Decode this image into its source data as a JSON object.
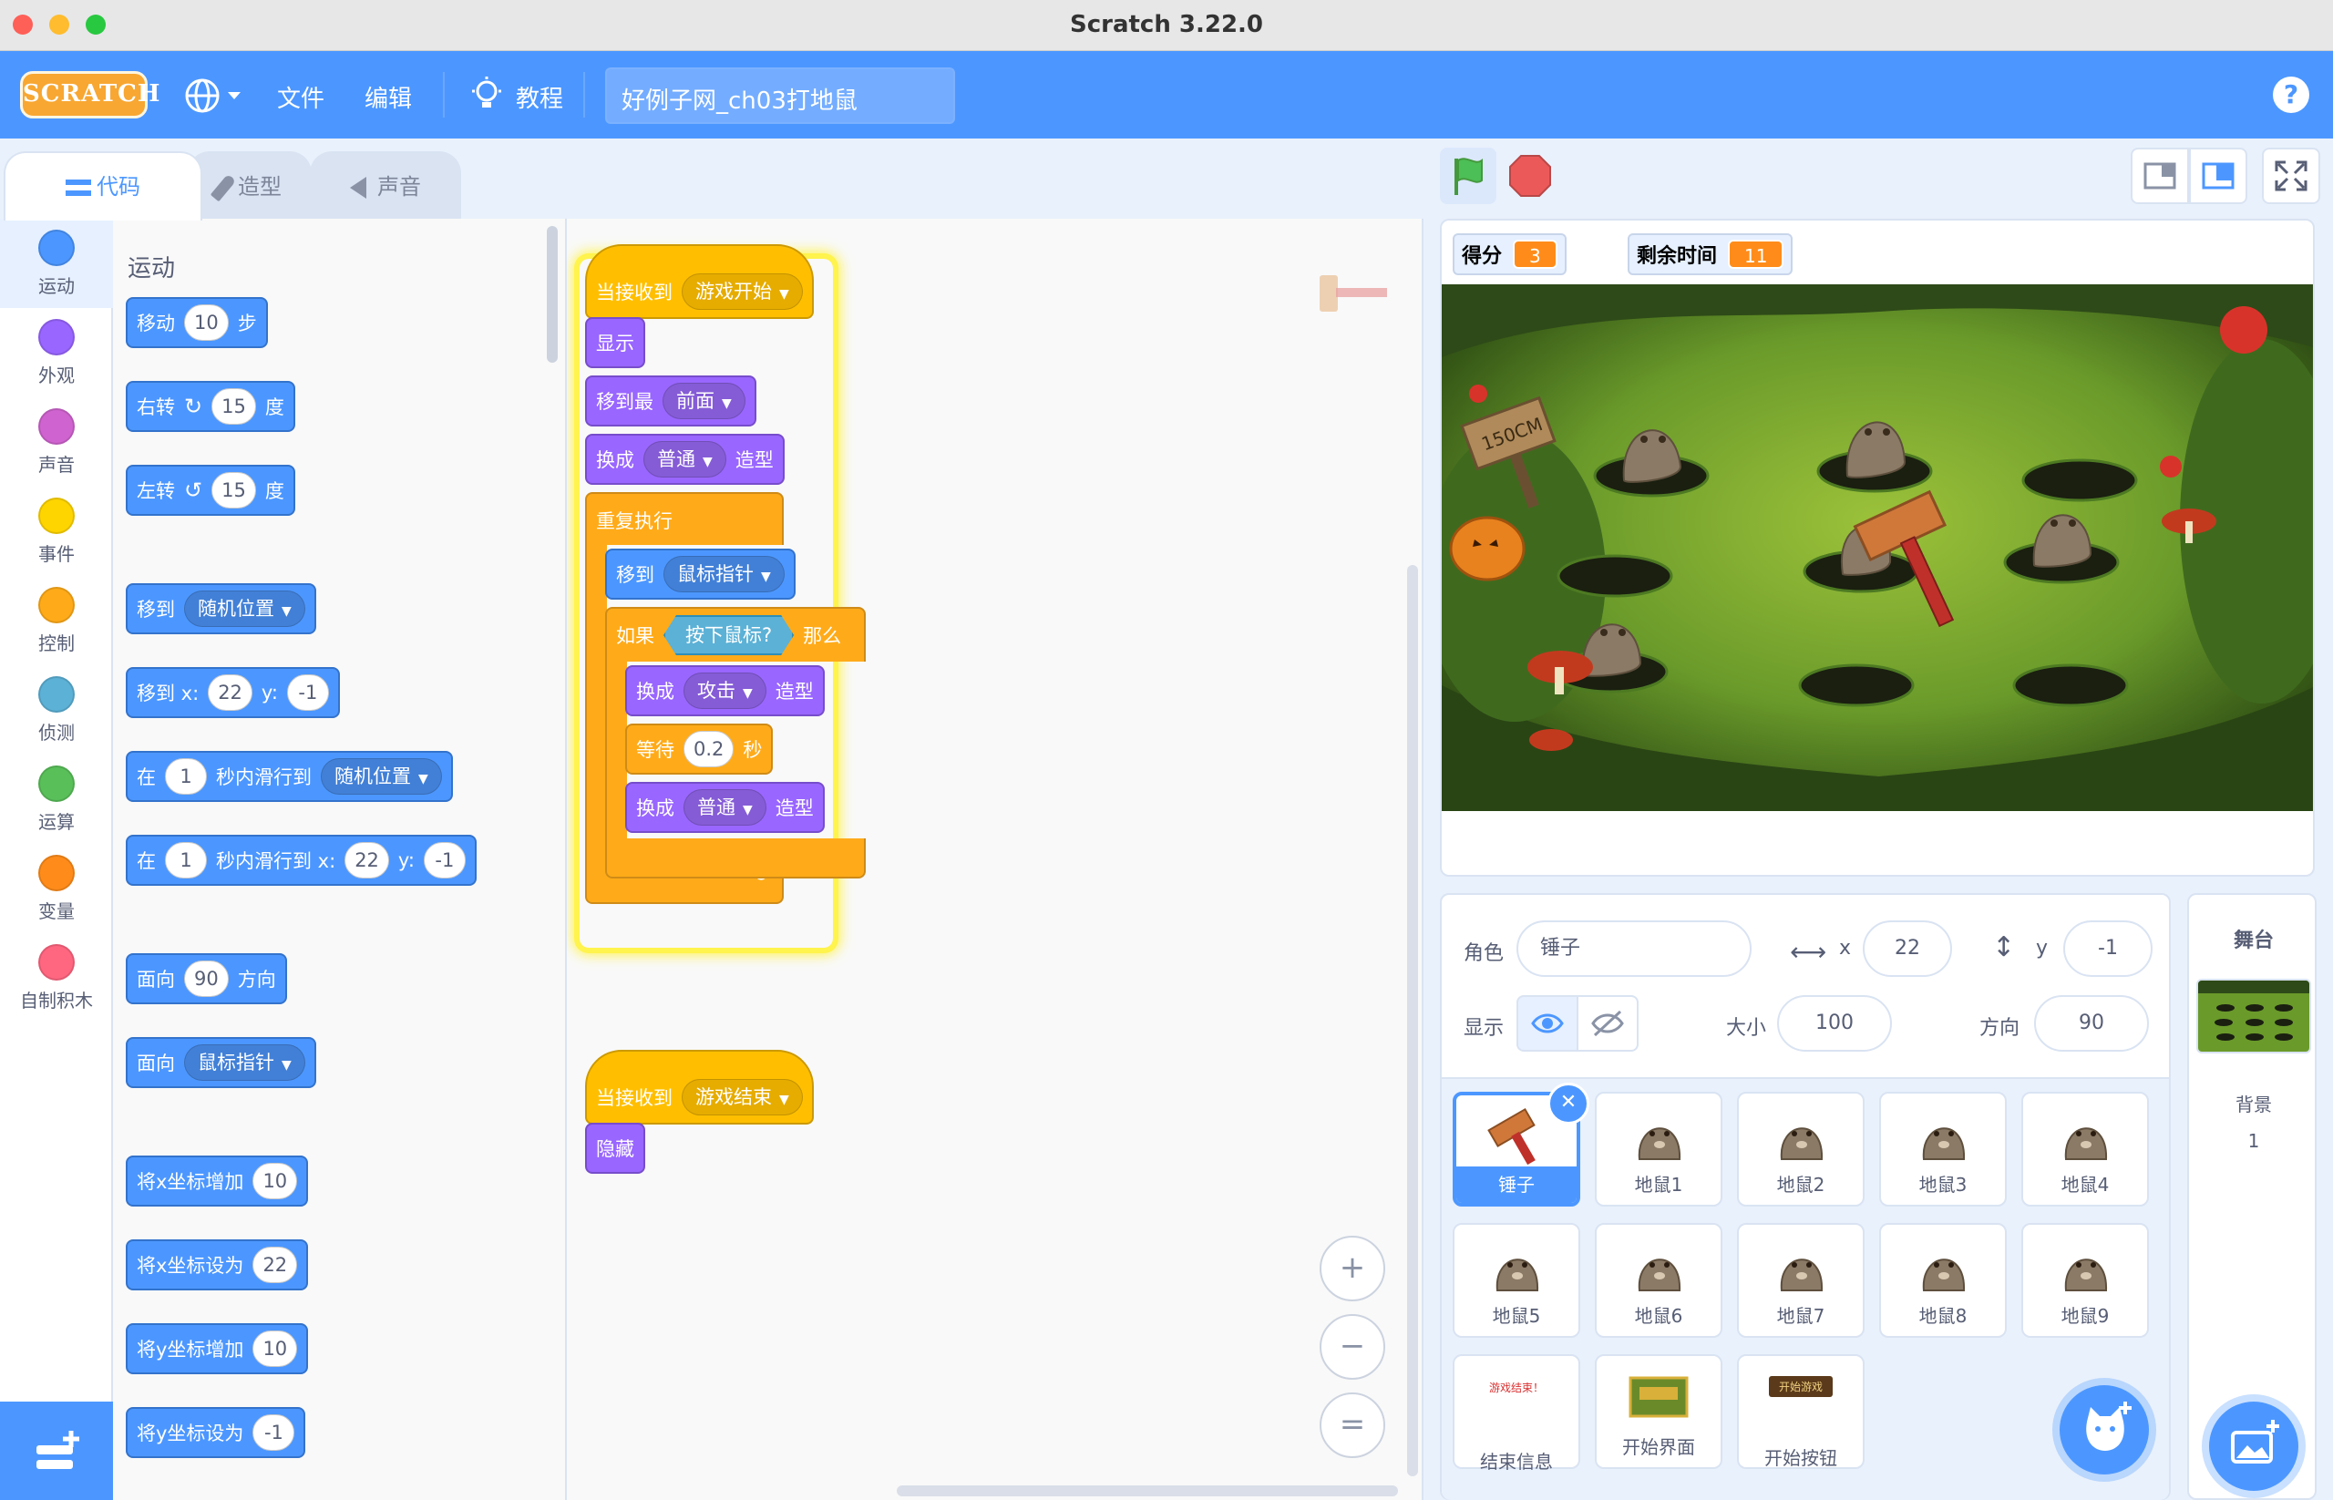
{
  "window": {
    "title": "Scratch 3.22.0"
  },
  "menu": {
    "logo": "SCRATCH",
    "file": "文件",
    "edit": "编辑",
    "tutorials": "教程",
    "project_title": "好例子网_ch03打地鼠",
    "help": "?"
  },
  "tabs": [
    {
      "label": "代码"
    },
    {
      "label": "造型"
    },
    {
      "label": "声音"
    }
  ],
  "categories": [
    {
      "label": "运动",
      "color": "#4c97ff"
    },
    {
      "label": "外观",
      "color": "#9966ff"
    },
    {
      "label": "声音",
      "color": "#cf63cf"
    },
    {
      "label": "事件",
      "color": "#ffd500"
    },
    {
      "label": "控制",
      "color": "#ffab19"
    },
    {
      "label": "侦测",
      "color": "#5cb1d6"
    },
    {
      "label": "运算",
      "color": "#59c059"
    },
    {
      "label": "变量",
      "color": "#ff8c1a"
    },
    {
      "label": "自制积木",
      "color": "#ff6680"
    }
  ],
  "palette": {
    "header": "运动",
    "move": {
      "a": "移动",
      "v": "10",
      "b": "步"
    },
    "turn_right": {
      "a": "右转",
      "v": "15",
      "b": "度"
    },
    "turn_left": {
      "a": "左转",
      "v": "15",
      "b": "度"
    },
    "goto": {
      "a": "移到",
      "dd": "随机位置"
    },
    "goto_xy": {
      "a": "移到 x:",
      "x": "22",
      "b": "y:",
      "y": "-1"
    },
    "glide": {
      "a": "在",
      "v": "1",
      "b": "秒内滑行到",
      "dd": "随机位置"
    },
    "glide_xy": {
      "a": "在",
      "v": "1",
      "b": "秒内滑行到 x:",
      "x": "22",
      "c": "y:",
      "y": "-1"
    },
    "point_dir": {
      "a": "面向",
      "v": "90",
      "b": "方向"
    },
    "point_towards": {
      "a": "面向",
      "dd": "鼠标指针"
    },
    "change_x": {
      "a": "将x坐标增加",
      "v": "10"
    },
    "set_x": {
      "a": "将x坐标设为",
      "v": "22"
    },
    "change_y": {
      "a": "将y坐标增加",
      "v": "10"
    },
    "set_y": {
      "a": "将y坐标设为",
      "v": "-1"
    }
  },
  "script1": {
    "hat": {
      "a": "当接收到",
      "dd": "游戏开始"
    },
    "show": "显示",
    "front": {
      "a": "移到最",
      "dd": "前面"
    },
    "costume1": {
      "a": "换成",
      "dd": "普通",
      "b": "造型"
    },
    "forever": "重复执行",
    "goto": {
      "a": "移到",
      "dd": "鼠标指针"
    },
    "if": {
      "a": "如果",
      "cond": "按下鼠标?",
      "b": "那么"
    },
    "costume2": {
      "a": "换成",
      "dd": "攻击",
      "b": "造型"
    },
    "wait": {
      "a": "等待",
      "v": "0.2",
      "b": "秒"
    },
    "costume3": {
      "a": "换成",
      "dd": "普通",
      "b": "造型"
    }
  },
  "script2": {
    "hat": {
      "a": "当接收到",
      "dd": "游戏结束"
    },
    "hide": "隐藏"
  },
  "zoom": {
    "in": "+",
    "out": "−",
    "reset": "="
  },
  "stage": {
    "monitors": [
      {
        "label": "得分",
        "value": "3"
      },
      {
        "label": "剩余时间",
        "value": "11"
      }
    ],
    "sign": "150CM"
  },
  "sprite_info": {
    "sprite_label": "角色",
    "sprite_name": "锤子",
    "x_label": "x",
    "x": "22",
    "y_label": "y",
    "y": "-1",
    "show_label": "显示",
    "size_label": "大小",
    "size": "100",
    "direction_label": "方向",
    "direction": "90"
  },
  "sprites": [
    {
      "name": "锤子",
      "kind": "hammer",
      "selected": true
    },
    {
      "name": "地鼠1",
      "kind": "mole"
    },
    {
      "name": "地鼠2",
      "kind": "mole"
    },
    {
      "name": "地鼠3",
      "kind": "mole"
    },
    {
      "name": "地鼠4",
      "kind": "mole"
    },
    {
      "name": "地鼠5",
      "kind": "mole"
    },
    {
      "name": "地鼠6",
      "kind": "mole"
    },
    {
      "name": "地鼠7",
      "kind": "mole"
    },
    {
      "name": "地鼠8",
      "kind": "mole"
    },
    {
      "name": "地鼠9",
      "kind": "mole"
    },
    {
      "name": "结束信息",
      "kind": "text",
      "thumb_text": "游戏结束！"
    },
    {
      "name": "开始界面",
      "kind": "banner"
    },
    {
      "name": "开始按钮",
      "kind": "button",
      "thumb_text": "开始游戏"
    }
  ],
  "stage_panel": {
    "title": "舞台",
    "backdrops_label": "背景",
    "backdrops_count": "1"
  }
}
